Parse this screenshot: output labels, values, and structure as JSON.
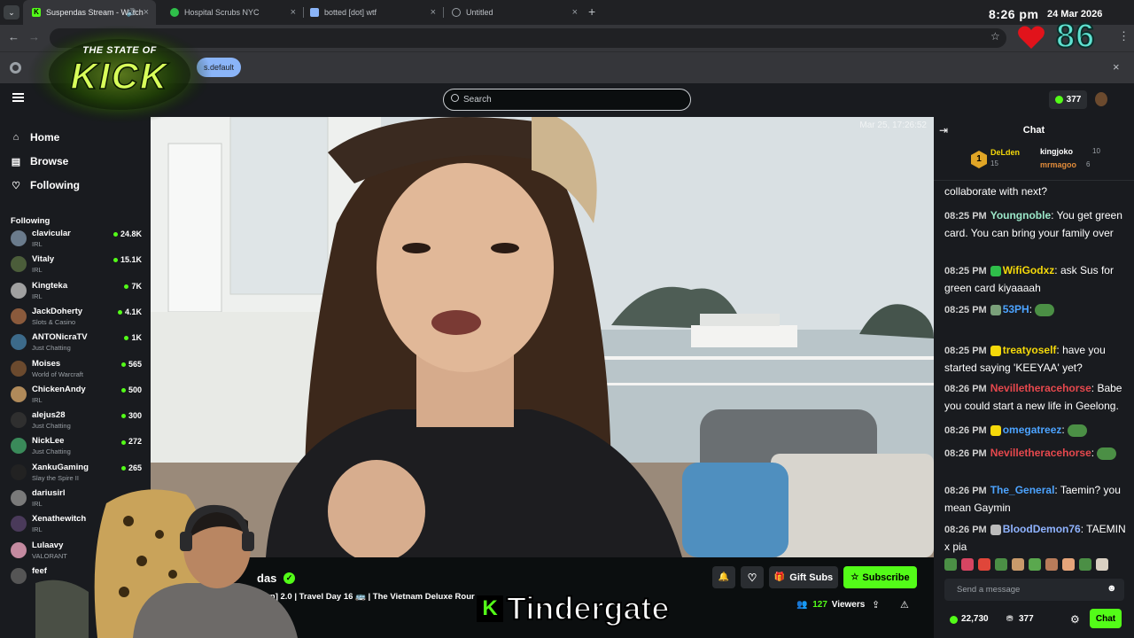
{
  "browser": {
    "tabs": [
      {
        "label": "Suspendas Stream - Watch",
        "icon": "kick-favicon"
      },
      {
        "label": "Hospital Scrubs NYC",
        "icon": "play-favicon"
      },
      {
        "label": "botted [dot] wtf",
        "icon": "bot-favicon"
      },
      {
        "label": "Untitled",
        "icon": "globe-favicon"
      }
    ],
    "new_tab": "+",
    "bookmark_chip": "s.default"
  },
  "overlay": {
    "logo_top": "THE STATE OF",
    "logo_main": "KICK",
    "clock": "8:26 pm",
    "date": "24 Mar 2026",
    "heart_count": "86",
    "caption_k": "K",
    "caption": "Tindergate"
  },
  "topnav": {
    "search_placeholder": "Search",
    "points": "377"
  },
  "sidebar": {
    "nav": [
      {
        "label": "Home",
        "icon": "home-icon"
      },
      {
        "label": "Browse",
        "icon": "browse-icon"
      },
      {
        "label": "Following",
        "icon": "heart-icon"
      }
    ],
    "following_title": "Following",
    "channels": [
      {
        "name": "clavicular",
        "category": "IRL",
        "viewers": "24.8K"
      },
      {
        "name": "Vitaly",
        "category": "IRL",
        "viewers": "15.1K"
      },
      {
        "name": "Kingteka",
        "category": "IRL",
        "viewers": "7K"
      },
      {
        "name": "JackDoherty",
        "category": "Slots & Casino",
        "viewers": "4.1K"
      },
      {
        "name": "ANTONicraTV",
        "category": "Just Chatting",
        "viewers": "1K"
      },
      {
        "name": "Moises",
        "category": "World of Warcraft",
        "viewers": "565"
      },
      {
        "name": "ChickenAndy",
        "category": "IRL",
        "viewers": "500"
      },
      {
        "name": "alejus28",
        "category": "Just Chatting",
        "viewers": "300"
      },
      {
        "name": "NickLee",
        "category": "Just Chatting",
        "viewers": "272"
      },
      {
        "name": "XankuGaming",
        "category": "Slay the Spire II",
        "viewers": "265"
      },
      {
        "name": "dariusirl",
        "category": "IRL",
        "viewers": ""
      },
      {
        "name": "Xenathewitch",
        "category": "IRL",
        "viewers": ""
      },
      {
        "name": "Lulaavy",
        "category": "VALORANT",
        "viewers": ""
      },
      {
        "name": "feef",
        "category": "",
        "viewers": ""
      }
    ]
  },
  "video": {
    "timestamp": "Mar 25, 17:26:52"
  },
  "stream_info": {
    "streamer": "das",
    "title": "m[vn] 2.0 | Travel Day 16 🚌 | The Vietnam Deluxe Rour",
    "gift_subs": "Gift Subs",
    "subscribe": "Subscribe",
    "viewers": "127",
    "viewers_label": "Viewers"
  },
  "chat": {
    "header": "Chat",
    "leaderboard": [
      {
        "rank": "1",
        "name": "DeLden",
        "count": "15"
      },
      {
        "name": "kingjoko",
        "count": "10"
      },
      {
        "name": "mrmagoo",
        "count": "6"
      }
    ],
    "partial_top": "collaborate with next?",
    "messages": [
      {
        "time": "08:25 PM",
        "user": "Youngnoble",
        "color": "#9be8c9",
        "text": "You get green card. You can bring your family over"
      },
      {
        "time": "08:25 PM",
        "user": "WifiGodxz",
        "color": "#f5d90a",
        "text": "ask Sus for green card kiyaaaah"
      },
      {
        "time": "08:25 PM",
        "user": "53PH",
        "color": "#4ca3ff",
        "text": ""
      },
      {
        "time": "08:25 PM",
        "user": "treatyoself",
        "color": "#f5d90a",
        "text": "have you started saying 'KEEYAA' yet?"
      },
      {
        "time": "08:26 PM",
        "user": "Nevilletheracehorse",
        "color": "#e5484d",
        "text": "Babe you could start a new life in Geelong."
      },
      {
        "time": "08:26 PM",
        "user": "omegatreez",
        "color": "#4ca3ff",
        "text": ""
      },
      {
        "time": "08:26 PM",
        "user": "Nevilletheracehorse",
        "color": "#e5484d",
        "text": ""
      },
      {
        "time": "08:26 PM",
        "user": "The_General",
        "color": "#4ca3ff",
        "text": "Taemin? you mean Gaymin"
      },
      {
        "time": "08:26 PM",
        "user": "BloodDemon76",
        "color": "#8fb3ff",
        "text": "TAEMIN x pia"
      }
    ],
    "input_placeholder": "Send a message",
    "balance": "22,730",
    "points": "377",
    "chat_button": "Chat"
  },
  "colors": {
    "kick_green": "#53fc18",
    "panel": "#191b1f",
    "background": "#0b0e0f"
  }
}
